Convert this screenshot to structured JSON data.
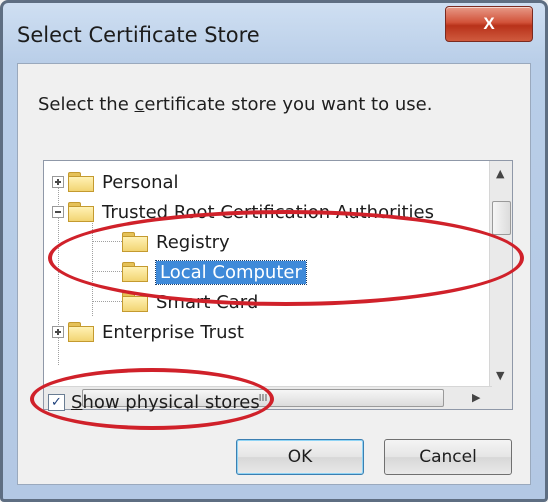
{
  "window": {
    "title": "Select Certificate Store",
    "close_label": "X"
  },
  "prompt": {
    "before": "Select the ",
    "accel": "c",
    "after": "ertificate store you want to use."
  },
  "tree": {
    "items": [
      {
        "label": "Personal",
        "expander": "plus"
      },
      {
        "label": "Trusted Root Certification Authorities",
        "expander": "minus"
      },
      {
        "label": "Registry"
      },
      {
        "label": "Local Computer",
        "selected": true
      },
      {
        "label": "Smart Card"
      },
      {
        "label": "Enterprise Trust",
        "expander": "plus"
      }
    ],
    "hscroll_grip": "III"
  },
  "checkbox": {
    "accel": "S",
    "rest": "how physical stores",
    "checked": true,
    "mark": "✓"
  },
  "buttons": {
    "ok": "OK",
    "cancel": "Cancel"
  },
  "colors": {
    "annotation": "#d0212a",
    "selection": "#3f8ad9"
  }
}
